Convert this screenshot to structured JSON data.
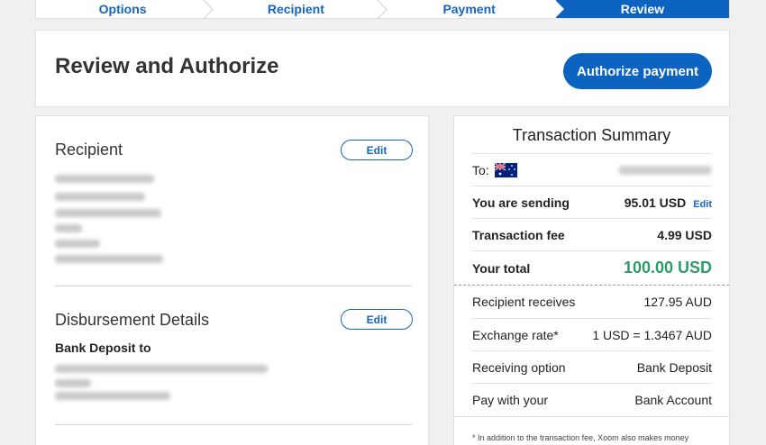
{
  "stepper": {
    "steps": [
      {
        "label": "Options"
      },
      {
        "label": "Recipient"
      },
      {
        "label": "Payment"
      },
      {
        "label": "Review"
      }
    ],
    "active_index": 3
  },
  "header": {
    "title": "Review and Authorize",
    "authorize_label": "Authorize payment"
  },
  "recipient": {
    "title": "Recipient",
    "edit_label": "Edit"
  },
  "disbursement": {
    "title": "Disbursement Details",
    "edit_label": "Edit",
    "bank_deposit_label": "Bank Deposit to"
  },
  "summary": {
    "title": "Transaction Summary",
    "to_label": "To:",
    "rows": [
      {
        "label": "You are sending",
        "value": "95.01 USD",
        "edit": "Edit"
      },
      {
        "label": "Transaction fee",
        "value": "4.99 USD"
      },
      {
        "label": "Your total",
        "value": "100.00 USD"
      },
      {
        "label": "Recipient receives",
        "value": "127.95 AUD"
      },
      {
        "label": "Exchange rate*",
        "value": "1 USD = 1.3467 AUD"
      },
      {
        "label": "Receiving option",
        "value": "Bank Deposit"
      },
      {
        "label": "Pay with your",
        "value": "Bank Account"
      }
    ],
    "footnote": "* In addition to the transaction fee, Xoom also makes money"
  },
  "colors": {
    "brand_blue": "#0d64c0",
    "total_green": "#2e9b6b"
  }
}
